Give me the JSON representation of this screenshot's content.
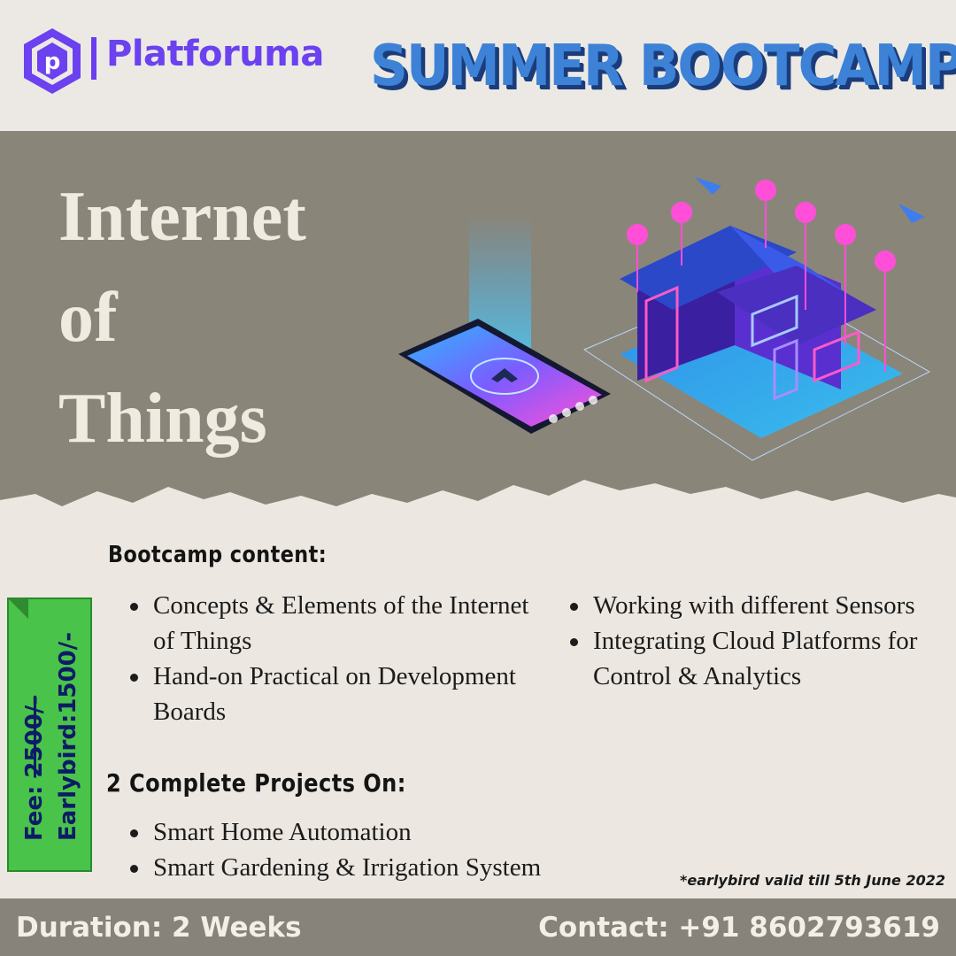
{
  "brand": {
    "name": "Platforuma",
    "colors": {
      "primary": "#6b41f0",
      "banner": "#3d82d6",
      "hero_bg": "#8a8579",
      "badge_green": "#49c34a"
    }
  },
  "banner": {
    "text": "SUMMER BOOTCAMP"
  },
  "hero": {
    "title_line1": "Internet",
    "title_line2": "of",
    "title_line3": "Things"
  },
  "content": {
    "heading": "Bootcamp content:",
    "items_left": [
      "Concepts & Elements of the Internet of Things",
      "Hand-on Practical on Development Boards"
    ],
    "items_right": [
      "Working with different Sensors",
      "Integrating Cloud Platforms for Control & Analytics"
    ],
    "projects_heading": "2 Complete Projects On:",
    "projects": [
      "Smart Home Automation",
      "Smart Gardening & Irrigation System"
    ]
  },
  "fee": {
    "label": "Fee:",
    "original": "2500/-",
    "earlybird": "Earlybird:1500/-"
  },
  "note": "*earlybird valid till 5th June 2022",
  "footer": {
    "duration": "Duration: 2 Weeks",
    "contact": "Contact: +91 8602793619"
  }
}
